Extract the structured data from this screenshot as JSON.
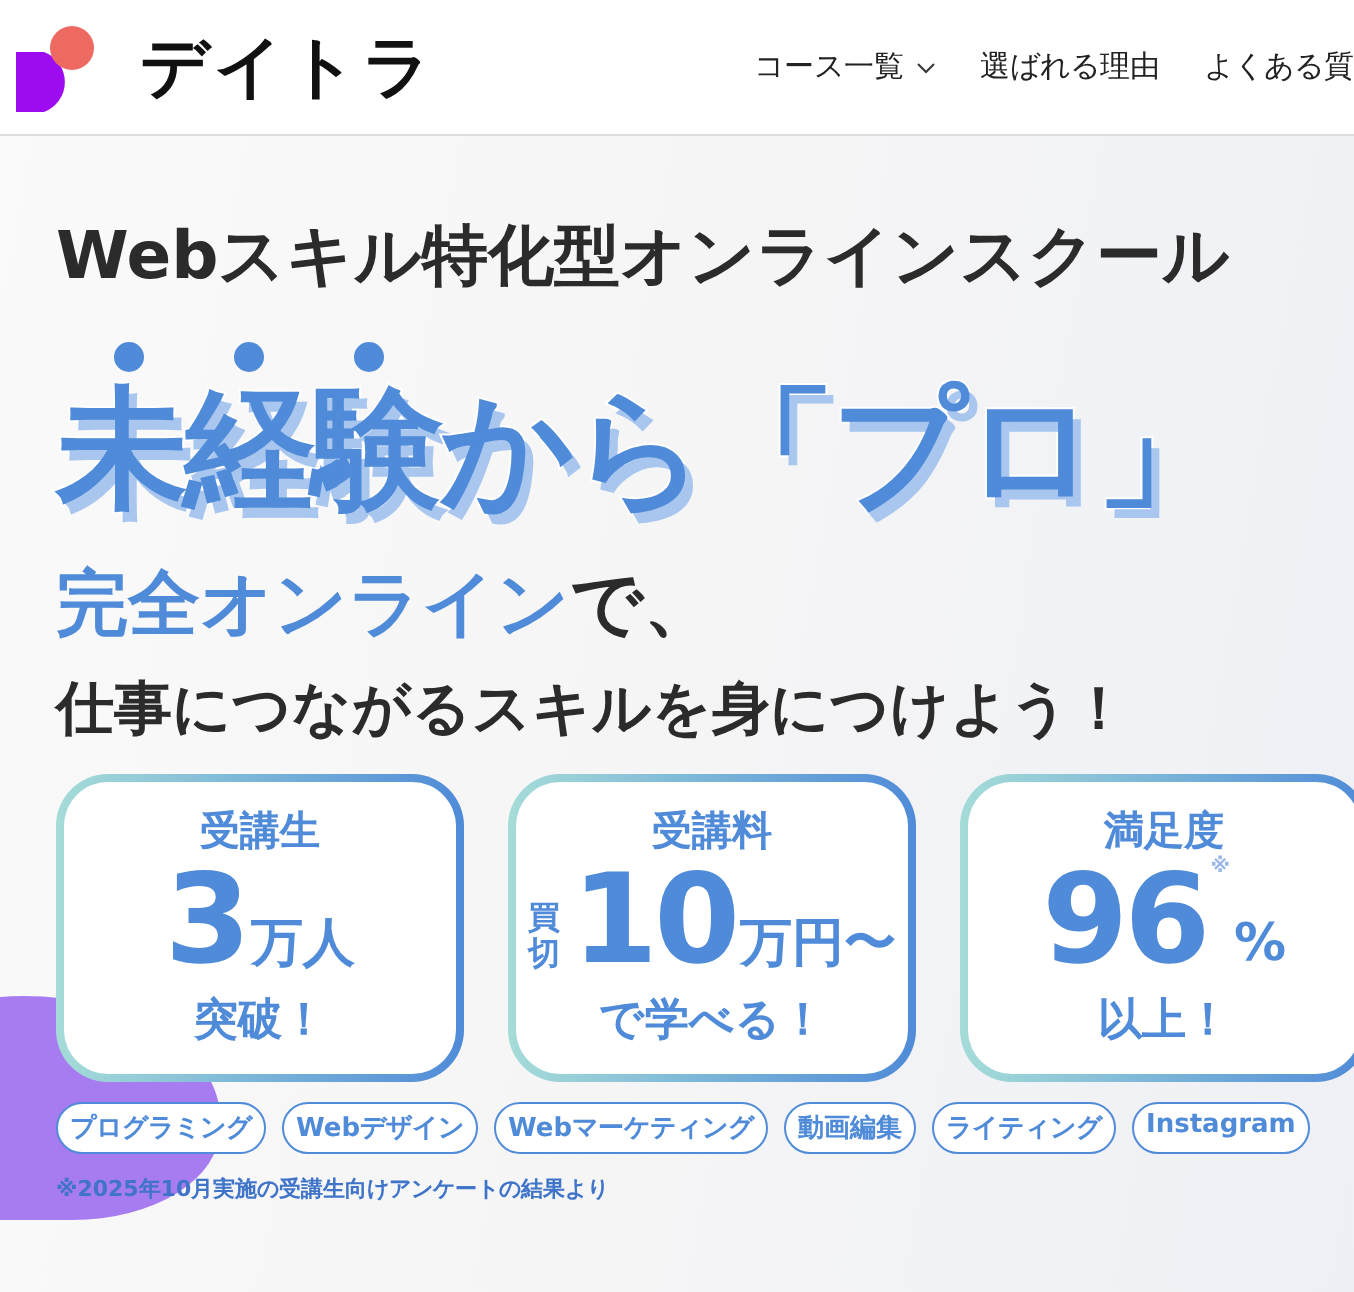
{
  "header": {
    "logo_text": "デイトラ",
    "nav": [
      {
        "label": "コース一覧",
        "has_menu": true
      },
      {
        "label": "選ばれる理由",
        "has_menu": false
      },
      {
        "label": "よくある質",
        "has_menu": false
      }
    ]
  },
  "hero": {
    "tagline": "Webスキル特化型オンラインスクール",
    "headline": {
      "emphasis": "未経験",
      "rest": "から「プロ」"
    },
    "lead": {
      "highlight": "完全オンライン",
      "rest": "で、"
    },
    "sub": "仕事につながるスキルを身につけよう！",
    "stats": [
      {
        "label": "受講生",
        "value": "3",
        "unit": "万人",
        "note": "突破！"
      },
      {
        "label": "受講料",
        "prefix": "買切",
        "value": "10",
        "unit": "万円〜",
        "note": "で学べる！"
      },
      {
        "label": "満足度",
        "value": "96",
        "mark": "※",
        "unit": "%",
        "note": "以上！"
      }
    ],
    "tags": [
      "プログラミング",
      "Webデザイン",
      "Webマーケティング",
      "動画編集",
      "ライティング",
      "Instagram"
    ],
    "footnote": "※2025年10月実施の受講生向けアンケートの結果より"
  }
}
